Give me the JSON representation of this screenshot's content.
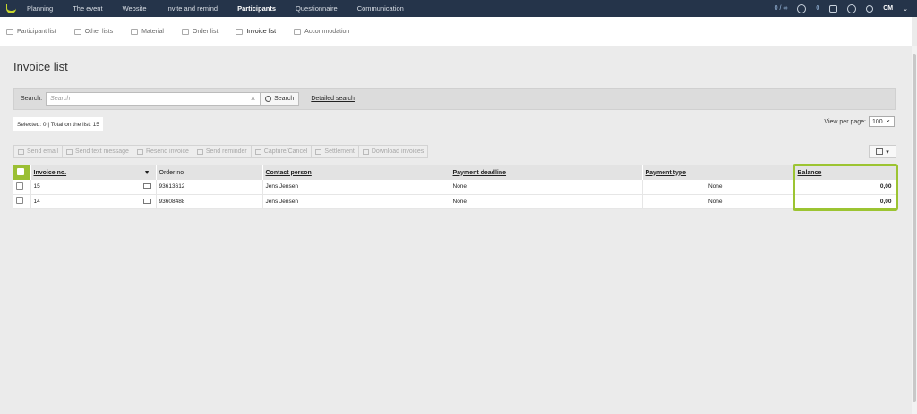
{
  "topnav": {
    "items": [
      "Planning",
      "The event",
      "Website",
      "Invite and remind",
      "Participants",
      "Questionnaire",
      "Communication"
    ],
    "active": "Participants",
    "counter1": "0 / ∞",
    "counter2": "0",
    "user": "CM"
  },
  "subnav": {
    "items": [
      "Participant list",
      "Other lists",
      "Material",
      "Order list",
      "Invoice list",
      "Accommodation"
    ],
    "active": "Invoice list"
  },
  "page": {
    "title": "Invoice list"
  },
  "search": {
    "label": "Search:",
    "placeholder": "Search",
    "button": "Search",
    "detailed": "Detailed search"
  },
  "selection": {
    "text": "Selected: 0 | Total on the list: 15"
  },
  "view_per_page": {
    "label": "View per page:",
    "value": "100"
  },
  "actions": [
    "Send email",
    "Send text message",
    "Resend invoice",
    "Send reminder",
    "Capture/Cancel",
    "Settlement",
    "Download invoices"
  ],
  "table": {
    "headers": {
      "invoice": "Invoice no.",
      "order": "Order no",
      "contact": "Contact person",
      "deadline": "Payment deadline",
      "ptype": "Payment type",
      "balance": "Balance"
    },
    "rows": [
      {
        "invoice": "15",
        "order": "93613612",
        "contact": "Jens Jensen",
        "deadline": "None",
        "ptype": "None",
        "balance": "0,00"
      },
      {
        "invoice": "14",
        "order": "93608488",
        "contact": "Jens Jensen",
        "deadline": "None",
        "ptype": "None",
        "balance": "0,00"
      }
    ]
  },
  "colors": {
    "nav": "#25344a",
    "accent": "#9cc432"
  }
}
